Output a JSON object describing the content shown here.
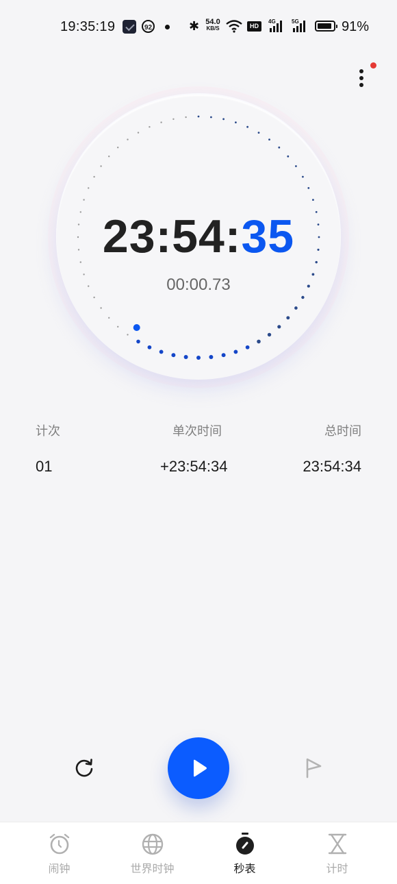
{
  "status_bar": {
    "time": "19:35:19",
    "notification_badge": "92",
    "net_speed_value": "54.0",
    "net_speed_unit": "KB/S",
    "hd_label": "HD",
    "signal_1_label": "4G",
    "signal_2_label": "5G",
    "battery_level": 0.91,
    "battery_text": "91%"
  },
  "header": {
    "more_menu_has_badge": true
  },
  "stopwatch": {
    "main_time_hm": "23:54:",
    "main_time_sec": "35",
    "sub_time": "00:00.73",
    "dial_total_ticks": 60,
    "dial_progress_ticks": 35,
    "accent_color": "#0b57f0"
  },
  "laps": {
    "headers": {
      "lap": "计次",
      "split": "单次时间",
      "total": "总时间"
    },
    "rows": [
      {
        "lap": "01",
        "split": "+23:54:34",
        "total": "23:54:34"
      }
    ]
  },
  "controls": {
    "reset": "reset-icon",
    "start": "play-icon",
    "lap": "flag-icon"
  },
  "tabs": [
    {
      "label": "闹钟",
      "icon": "alarm-icon",
      "active": false
    },
    {
      "label": "世界时钟",
      "icon": "globe-icon",
      "active": false
    },
    {
      "label": "秒表",
      "icon": "stopwatch-icon",
      "active": true
    },
    {
      "label": "计时",
      "icon": "hourglass-icon",
      "active": false
    }
  ]
}
